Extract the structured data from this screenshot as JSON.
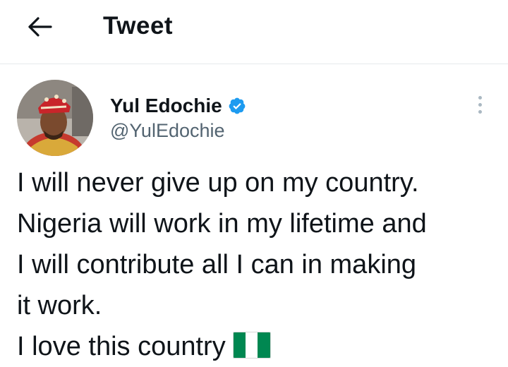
{
  "header": {
    "back_icon": "arrow-left-icon",
    "title": "Tweet"
  },
  "tweet": {
    "author": {
      "display_name": "Yul Edochie",
      "handle": "@YulEdochie",
      "verified": true,
      "verified_icon": "verified-badge-icon",
      "verified_color": "#1d9bf0"
    },
    "more_icon": "more-vertical-icon",
    "text_lines": [
      "I will never give up on my country.",
      "Nigeria will work in my lifetime and",
      "I will contribute all I can in making",
      "it work.",
      "I love this country"
    ],
    "flag_emoji": "nigeria-flag-icon",
    "flag_colors": [
      "#008751",
      "#ffffff",
      "#008751"
    ]
  }
}
